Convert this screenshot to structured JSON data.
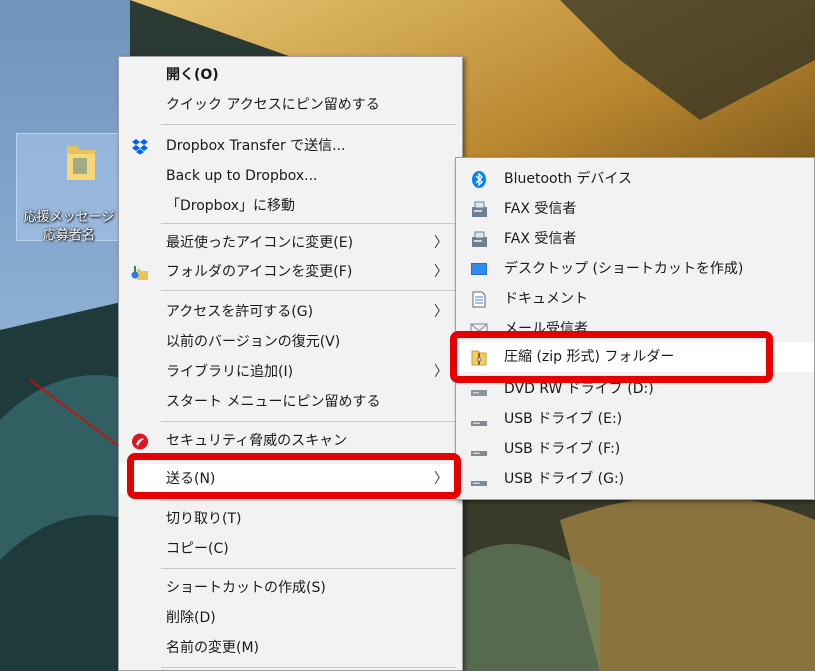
{
  "desktop": {
    "folder_name_line1": "応援メッセージ",
    "folder_name_line2": "応募者名"
  },
  "context_menu": {
    "open": "開く(O)",
    "pin_quick_access": "クイック アクセスにピン留めする",
    "dropbox_transfer": "Dropbox Transfer で送信...",
    "backup_dropbox": "Back up to Dropbox...",
    "move_dropbox": "「Dropbox」に移動",
    "change_recent_icon": "最近使ったアイコンに変更(E)",
    "change_folder_icon": "フォルダのアイコンを変更(F)",
    "grant_access": "アクセスを許可する(G)",
    "restore_versions": "以前のバージョンの復元(V)",
    "add_to_library": "ライブラリに追加(I)",
    "pin_start": "スタート メニューにピン留めする",
    "security_scan": "セキュリティ脅威のスキャン",
    "send_to": "送る(N)",
    "cut": "切り取り(T)",
    "copy": "コピー(C)",
    "create_shortcut": "ショートカットの作成(S)",
    "delete": "削除(D)",
    "rename": "名前の変更(M)"
  },
  "send_to_menu": {
    "bluetooth": "Bluetooth デバイス",
    "fax1": "FAX 受信者",
    "fax2": "FAX 受信者",
    "desktop_shortcut": "デスクトップ (ショートカットを作成)",
    "documents": "ドキュメント",
    "mail": "メール受信者",
    "zip": "圧縮 (zip 形式) フォルダー",
    "dvd": "DVD RW ドライブ (D:)",
    "usb_e": "USB ドライブ (E:)",
    "usb_f": "USB ドライブ (F:)",
    "usb_g": "USB ドライブ (G:)"
  },
  "arrow_glyph": "〉",
  "colors": {
    "highlight_box": "#e60000",
    "menu_bg": "#f2f2f2",
    "dropbox_blue": "#0061fe",
    "bluetooth_blue": "#0082fc"
  }
}
